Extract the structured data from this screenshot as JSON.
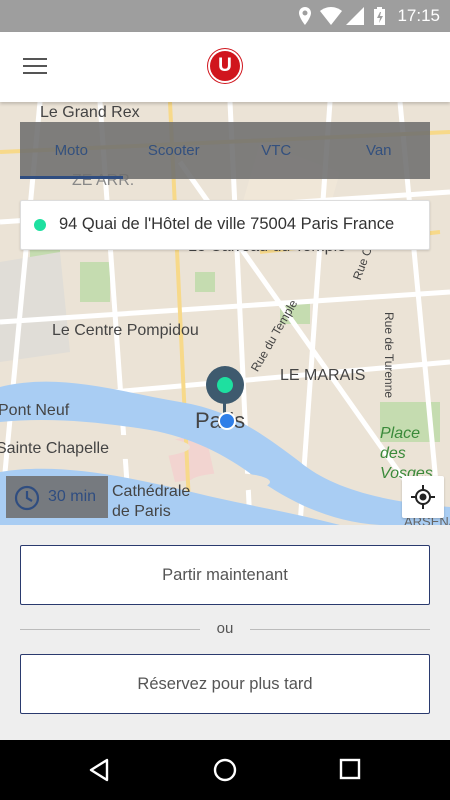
{
  "status_bar": {
    "time": "17:15",
    "icons": [
      "location-icon",
      "wifi-icon",
      "signal-icon",
      "battery-icon"
    ]
  },
  "app_bar": {
    "menu_icon": "hamburger-menu-icon",
    "logo_letter": "U",
    "logo_color": "#d0151d"
  },
  "map": {
    "labels": [
      "Le Grand Rex",
      "ZE ARR.",
      "Le Carreau du Temple",
      "Rue Charlot",
      "Le Centre Pompidou",
      "Rue du Temple",
      "Rue de Turenne",
      "LE MARAIS",
      "Paris",
      "Pont Neuf",
      "Sainte Chapelle",
      "Place des Vosges",
      "Cathédrale de Paris",
      "ARSENAL"
    ]
  },
  "tabs": [
    {
      "label": "Moto",
      "active": true
    },
    {
      "label": "Scooter",
      "active": false
    },
    {
      "label": "VTC",
      "active": false
    },
    {
      "label": "Van",
      "active": false
    }
  ],
  "address": {
    "text": "94 Quai de l'Hôtel de ville 75004 Paris France",
    "dot_color": "#1ee0a0"
  },
  "eta": {
    "label": "30 min",
    "icon": "clock-icon"
  },
  "locate_icon": "my-location-icon",
  "actions": {
    "now_label": "Partir maintenant",
    "or_label": "ou",
    "later_label": "Réservez pour plus tard"
  },
  "nav_bar": {
    "icons": [
      "back-icon",
      "home-icon",
      "recents-icon"
    ]
  },
  "colors": {
    "accent": "#2f4d80",
    "status_bar": "#9e9e9e",
    "pin": "#3e5a6e"
  }
}
